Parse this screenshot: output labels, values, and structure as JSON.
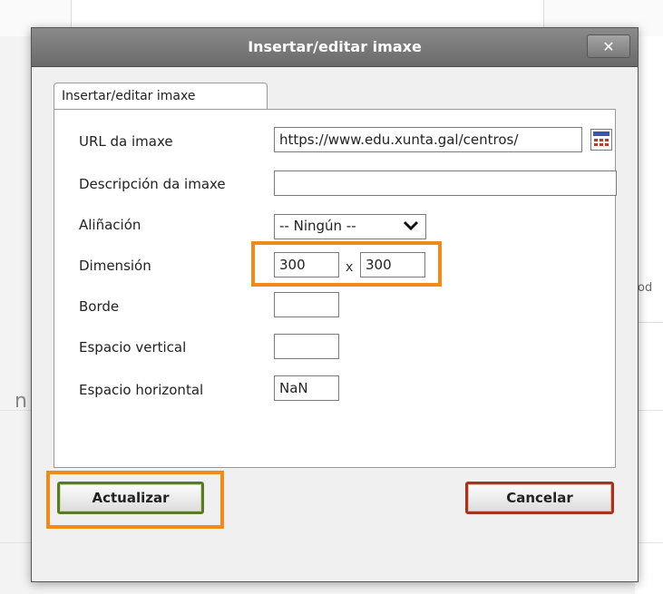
{
  "background": {
    "right_text": "rod",
    "left_text": "n"
  },
  "dialog": {
    "title": "Insertar/editar imaxe",
    "close_label": "✕",
    "tab_label": "Insertar/editar imaxe",
    "fields": {
      "url": {
        "label": "URL da imaxe",
        "value": "https://www.edu.xunta.gal/centros/"
      },
      "description": {
        "label": "Descripción da imaxe",
        "value": ""
      },
      "alignment": {
        "label": "Aliñación",
        "value": "-- Ningún --"
      },
      "dimension": {
        "label": "Dimensión",
        "width": "300",
        "separator": "x",
        "height": "300"
      },
      "border": {
        "label": "Borde",
        "value": ""
      },
      "vspace": {
        "label": "Espacio vertical",
        "value": ""
      },
      "hspace": {
        "label": "Espacio horizontal",
        "value": "NaN"
      }
    },
    "buttons": {
      "update": "Actualizar",
      "cancel": "Cancelar"
    },
    "colors": {
      "highlight": "#f28a1a",
      "update_border": "#5a7a2a",
      "cancel_border": "#a8321e",
      "titlebar": "#7a7a7a"
    },
    "icons": [
      "close-icon",
      "image-browser-icon",
      "chevron-down-icon"
    ]
  }
}
